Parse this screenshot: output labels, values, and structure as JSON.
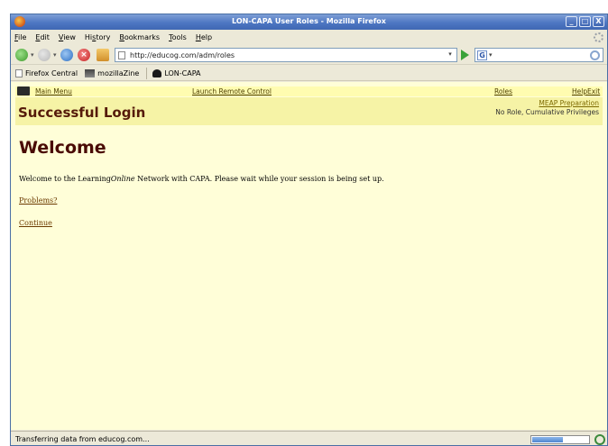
{
  "window": {
    "title": "LON-CAPA User Roles - Mozilla Firefox",
    "buttons": [
      "_",
      "□",
      "X"
    ]
  },
  "menubar": {
    "items": [
      {
        "acc": "F",
        "rest": "ile"
      },
      {
        "acc": "E",
        "rest": "dit"
      },
      {
        "acc": "V",
        "rest": "iew"
      },
      {
        "pre": "Hi",
        "acc": "s",
        "rest": "tory"
      },
      {
        "acc": "B",
        "rest": "ookmarks"
      },
      {
        "acc": "T",
        "rest": "ools"
      },
      {
        "acc": "H",
        "rest": "elp"
      }
    ]
  },
  "navbar": {
    "url": "http://educog.com/adm/roles",
    "search_engine": "G",
    "icons": [
      "back-arrow-icon",
      "forward-arrow-icon",
      "reload-icon",
      "stop-icon",
      "home-icon",
      "go-arrow-icon",
      "search-magnifier-icon"
    ]
  },
  "bookmarks": [
    {
      "label": "Firefox Central",
      "icon": "document-icon"
    },
    {
      "label": "mozillaZine",
      "icon": "mozillazine-icon"
    },
    {
      "label": "LON-CAPA",
      "icon": "lon-capa-icon"
    }
  ],
  "lonCapa": {
    "menu": {
      "main_menu": "Main Menu",
      "launch_remote": "Launch Remote Control",
      "roles": "Roles",
      "help": "Help",
      "exit": "Exit"
    },
    "header": {
      "title": "Successful Login",
      "course": "MEAP Preparation",
      "role": "No Role, Cumulative Privileges"
    },
    "welcome_heading": "Welcome",
    "message_before": "Welcome to the Learning",
    "message_italic": "Online",
    "message_after": " Network with CAPA. Please wait while your session is being set up.",
    "problems_link": "Problems?",
    "continue_link": "Continue"
  },
  "statusbar": {
    "text": "Transferring data from educog.com...",
    "progress_fraction": 0.55
  },
  "colors": {
    "content_bg": "#fffed8",
    "menu_bg": "#fffcb0",
    "header_bg": "#f6f3a6",
    "heading_color": "#551a0a"
  }
}
